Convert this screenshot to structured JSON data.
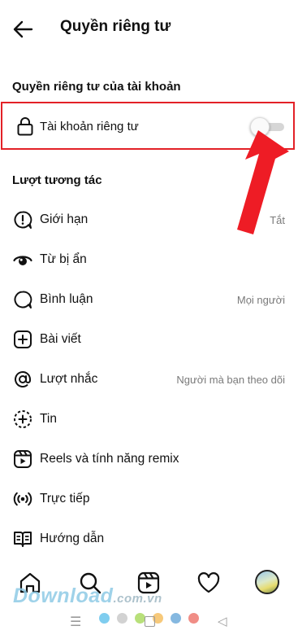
{
  "header": {
    "title": "Quyền riêng tư"
  },
  "account_section": {
    "title": "Quyền riêng tư của tài khoản"
  },
  "private_account": {
    "label": "Tài khoản riêng tư",
    "enabled": false
  },
  "interactions_section": {
    "title": "Lượt tương tác"
  },
  "interaction_items": [
    {
      "label": "Giới hạn",
      "value": "Tắt",
      "icon": "limit-icon"
    },
    {
      "label": "Từ bị ẩn",
      "value": "",
      "icon": "hidden-words-icon"
    },
    {
      "label": "Bình luận",
      "value": "Mọi người",
      "icon": "comment-icon"
    },
    {
      "label": "Bài viết",
      "value": "",
      "icon": "post-icon"
    },
    {
      "label": "Lượt nhắc",
      "value": "Người mà bạn theo dõi",
      "icon": "mention-icon"
    },
    {
      "label": "Tin",
      "value": "",
      "icon": "story-icon"
    },
    {
      "label": "Reels và tính năng remix",
      "value": "",
      "icon": "reels-icon"
    },
    {
      "label": "Trực tiếp",
      "value": "",
      "icon": "live-icon"
    },
    {
      "label": "Hướng dẫn",
      "value": "",
      "icon": "guide-icon"
    }
  ],
  "bottom_nav": [
    "home-icon",
    "search-icon",
    "reels-icon",
    "heart-icon",
    "profile-avatar"
  ],
  "watermark": {
    "main": "Download",
    "suffix": ".com.vn"
  },
  "colors": {
    "highlight": "#e32127",
    "arrow": "#ee1c25",
    "secondary_text": "#7a7a7a"
  }
}
